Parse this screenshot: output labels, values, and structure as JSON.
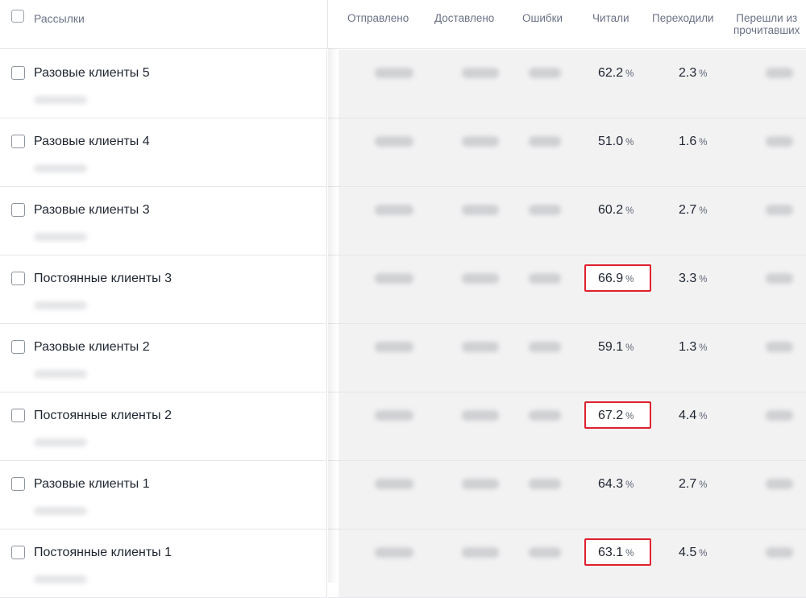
{
  "header": {
    "title": "Рассылки",
    "columns": [
      {
        "label": "Отправлено"
      },
      {
        "label": "Доставлено"
      },
      {
        "label": "Ошибки"
      },
      {
        "label": "Читали"
      },
      {
        "label": "Переходили"
      },
      {
        "label": "Перешли из\nпрочитавших"
      }
    ]
  },
  "rows": [
    {
      "name": "Разовые клиенты 5",
      "read": "62.2",
      "clicked": "2.3",
      "highlighted": false
    },
    {
      "name": "Разовые клиенты 4",
      "read": "51.0",
      "clicked": "1.6",
      "highlighted": false
    },
    {
      "name": "Разовые клиенты 3",
      "read": "60.2",
      "clicked": "2.7",
      "highlighted": false
    },
    {
      "name": "Постоянные клиенты 3",
      "read": "66.9",
      "clicked": "3.3",
      "highlighted": true
    },
    {
      "name": "Разовые клиенты 2",
      "read": "59.1",
      "clicked": "1.3",
      "highlighted": false
    },
    {
      "name": "Постоянные клиенты 2",
      "read": "67.2",
      "clicked": "4.4",
      "highlighted": true
    },
    {
      "name": "Разовые клиенты 1",
      "read": "64.3",
      "clicked": "2.7",
      "highlighted": false
    },
    {
      "name": "Постоянные клиенты 1",
      "read": "63.1",
      "clicked": "4.5",
      "highlighted": true
    }
  ],
  "unit": "%",
  "colors": {
    "highlight_border": "#e0212e",
    "header_text": "#6b7286",
    "metrics_background": "#f2f2f3"
  }
}
